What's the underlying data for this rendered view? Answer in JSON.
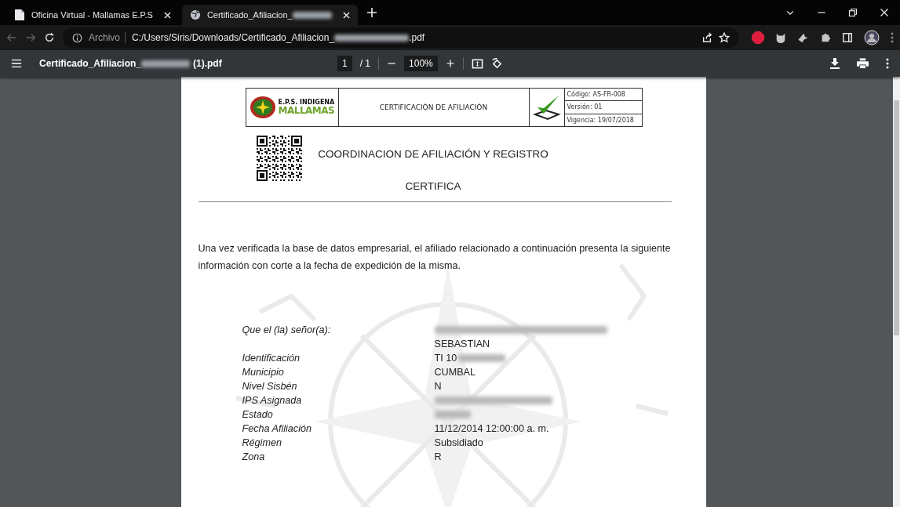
{
  "browser": {
    "tabs": [
      {
        "title": "Oficina Virtual - Mallamas E.P.S",
        "selected": false,
        "redacted": false,
        "kind": "doc"
      },
      {
        "title": "Certificado_Afiliacion_",
        "selected": true,
        "redacted": true,
        "kind": "globe"
      }
    ],
    "address": {
      "scheme": "Archivo",
      "path": "C:/Users/Siris/Downloads/Certificado_Afiliacion_",
      "path_end": ".pdf"
    }
  },
  "viewer": {
    "file_name": "Certificado_Afiliacion_",
    "file_name_end": "(1).pdf",
    "page": "1",
    "page_total": "/ 1",
    "zoom": "100%"
  },
  "document": {
    "header": {
      "logo_line1": "E.P.S. INDIGENA",
      "logo_line2": "MALLAMAS",
      "title": "CERTIFICACIÓN DE AFILIACIÓN",
      "meta": [
        "Código: AS-FR-008",
        "Versión: 01",
        "Vigencia: 19/07/2018"
      ]
    },
    "heading": "COORDINACION DE AFILIACIÓN Y REGISTRO",
    "subheading": "CERTIFICA",
    "intro": "Una vez verificada la base de datos empresarial, el afiliado relacionado a continuación presenta la siguiente información con corte a la fecha de expedición de la misma.",
    "fields": [
      {
        "label": "Que el (la) señor(a):",
        "value": "SEBASTIAN",
        "kind": "above"
      },
      {
        "label": "Identificación",
        "value": "TI 10",
        "kind": "partial"
      },
      {
        "label": "Municipio",
        "value": "CUMBAL",
        "kind": "plain"
      },
      {
        "label": "Nivel Sisbén",
        "value": "N",
        "kind": "plain"
      },
      {
        "label": "IPS Asignada",
        "kind": "hidden"
      },
      {
        "label": "Estado",
        "kind": "hidden_short"
      },
      {
        "label": "Fecha Afiliación",
        "value": "11/12/2014 12:00:00 a. m.",
        "kind": "plain"
      },
      {
        "label": "Régimen",
        "value": "Subsidiado",
        "kind": "plain"
      },
      {
        "label": "Zona",
        "value": "R",
        "kind": "plain"
      }
    ]
  }
}
